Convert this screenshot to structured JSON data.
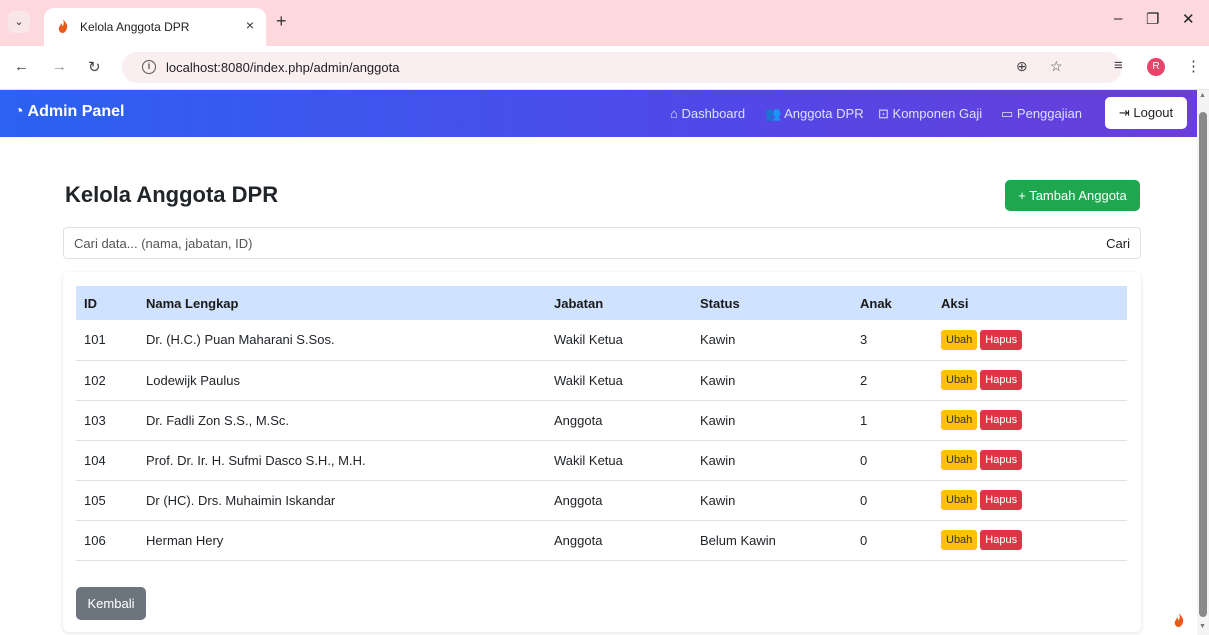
{
  "browser": {
    "tab_title": "Kelola Anggota DPR",
    "tab_close": "×",
    "new_tab": "+",
    "url": "localhost:8080/index.php/admin/anggota",
    "profile_initial": "R",
    "window_minimize": "–",
    "window_restore": "❐",
    "window_close": "✕"
  },
  "navbar": {
    "brand": "Admin Panel",
    "links": [
      {
        "icon": "home-icon",
        "label": "Dashboard"
      },
      {
        "icon": "people-icon",
        "label": "Anggota DPR"
      },
      {
        "icon": "money-icon",
        "label": "Komponen Gaji"
      },
      {
        "icon": "folder-icon",
        "label": "Penggajian"
      }
    ],
    "logout_label": "Logout"
  },
  "page": {
    "title": "Kelola Anggota DPR",
    "add_button": "+ Tambah Anggota",
    "search_placeholder": "Cari data... (nama, jabatan, ID)",
    "search_button": "Cari",
    "back_button": "Kembali"
  },
  "table": {
    "headers": [
      "ID",
      "Nama Lengkap",
      "Jabatan",
      "Status",
      "Anak",
      "Aksi"
    ],
    "edit_label": "Ubah",
    "delete_label": "Hapus",
    "rows": [
      {
        "id": "101",
        "nama": "Dr. (H.C.) Puan Maharani S.Sos.",
        "jabatan": "Wakil Ketua",
        "status": "Kawin",
        "anak": "3"
      },
      {
        "id": "102",
        "nama": "Lodewijk Paulus",
        "jabatan": "Wakil Ketua",
        "status": "Kawin",
        "anak": "2"
      },
      {
        "id": "103",
        "nama": "Dr. Fadli Zon S.S., M.Sc.",
        "jabatan": "Anggota",
        "status": "Kawin",
        "anak": "1"
      },
      {
        "id": "104",
        "nama": "Prof. Dr. Ir. H. Sufmi Dasco S.H., M.H.",
        "jabatan": "Wakil Ketua",
        "status": "Kawin",
        "anak": "0"
      },
      {
        "id": "105",
        "nama": "Dr (HC). Drs. Muhaimin Iskandar",
        "jabatan": "Anggota",
        "status": "Kawin",
        "anak": "0"
      },
      {
        "id": "106",
        "nama": "Herman Hery",
        "jabatan": "Anggota",
        "status": "Belum Kawin",
        "anak": "0"
      }
    ]
  },
  "colors": {
    "navbar_start": "#2b62f0",
    "navbar_end": "#6a3ed8",
    "success": "#1fa750",
    "warning": "#ffc107",
    "danger": "#dc3545",
    "secondary": "#6c757d",
    "table_header": "#cfe2ff"
  }
}
